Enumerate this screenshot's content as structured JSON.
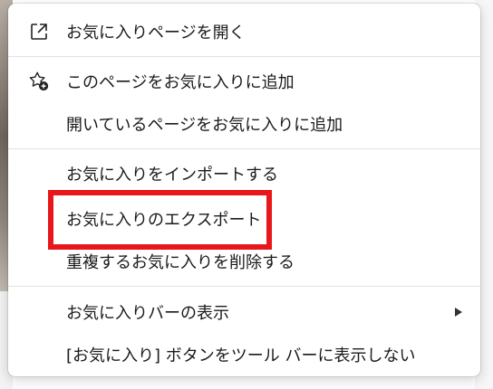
{
  "background": {
    "right_fragments": [
      "††",
      "††"
    ]
  },
  "menu": {
    "items": [
      {
        "label": "お気に入りページを開く",
        "icon": "open-external-icon"
      },
      {
        "label": "このページをお気に入りに追加",
        "icon": "star-add-icon"
      },
      {
        "label": "開いているページをお気に入りに追加",
        "icon": ""
      },
      {
        "label": "お気に入りをインポートする",
        "icon": ""
      },
      {
        "label": "お気に入りのエクスポート",
        "icon": ""
      },
      {
        "label": "重複するお気に入りを削除する",
        "icon": ""
      },
      {
        "label": "お気に入りバーの表示",
        "icon": "",
        "submenu": true
      },
      {
        "label": "[お気に入り] ボタンをツール バーに表示しない",
        "icon": ""
      }
    ],
    "highlight_color": "#e8171b"
  }
}
